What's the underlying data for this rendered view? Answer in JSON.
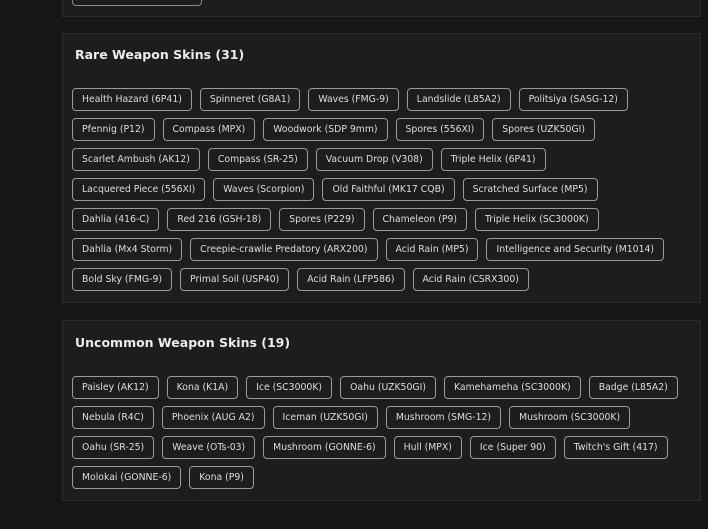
{
  "rare": {
    "title": "Rare Weapon Skins (31)",
    "rows": [
      [
        "Health Hazard (6P41)",
        "Spinneret (G8A1)",
        "Waves (FMG-9)",
        "Landslide (L85A2)",
        "Politsiya (SASG-12)"
      ],
      [
        "Pfennig (P12)",
        "Compass (MPX)",
        "Woodwork (SDP 9mm)",
        "Spores (556XI)",
        "Spores (UZK50GI)"
      ],
      [
        "Scarlet Ambush (AK12)",
        "Compass (SR-25)",
        "Vacuum Drop (V308)",
        "Triple Helix (6P41)"
      ],
      [
        "Lacquered Piece (556XI)",
        "Waves (Scorpion)",
        "Old Faithful (MK17 CQB)",
        "Scratched Surface (MP5)"
      ],
      [
        "Dahlia (416-C)",
        "Red 216 (GSH-18)",
        "Spores (P229)",
        "Chameleon (P9)",
        "Triple Helix (SC3000K)"
      ],
      [
        "Dahlia (Mx4 Storm)",
        "Creepie-crawlie Predatory (ARX200)",
        "Acid Rain (MP5)",
        "Intelligence and Security (M1014)"
      ],
      [
        "Bold Sky (FMG-9)",
        "Primal Soil (USP40)",
        "Acid Rain (LFP586)",
        "Acid Rain (CSRX300)"
      ]
    ]
  },
  "uncommon": {
    "title": "Uncommon Weapon Skins (19)",
    "rows": [
      [
        "Paisley (AK12)",
        "Kona (K1A)",
        "Ice (SC3000K)",
        "Oahu (UZK50GI)",
        "Kamehameha (SC3000K)",
        "Badge (L85A2)"
      ],
      [
        "Nebula (R4C)",
        "Phoenix (AUG A2)",
        "Iceman (UZK50GI)",
        "Mushroom (SMG-12)",
        "Mushroom (SC3000K)"
      ],
      [
        "Oahu (SR-25)",
        "Weave (OTs-03)",
        "Mushroom (GONNE-6)",
        "Hull (MPX)",
        "Ice (Super 90)",
        "Twitch's Gift (417)"
      ],
      [
        "Molokai (GONNE-6)",
        "Kona (P9)"
      ]
    ]
  }
}
